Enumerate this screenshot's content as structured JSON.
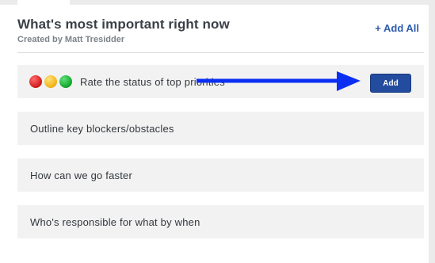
{
  "header": {
    "title": "What's most important right now",
    "subtitle": "Created by Matt Tresidder",
    "add_all_label": "+ Add All"
  },
  "rows": [
    {
      "label": "Rate the status of top priorities",
      "status_dots": [
        "red",
        "yellow",
        "green"
      ],
      "button_label": "Add"
    },
    {
      "label": "Outline key blockers/obstacles"
    },
    {
      "label": "How can we go faster"
    },
    {
      "label": "Who's responsible for what by when"
    }
  ],
  "colors": {
    "accent": "#234c9e",
    "link": "#2f5cb0",
    "arrow": "#0b2ff2",
    "row_background": "#f2f2f2"
  }
}
